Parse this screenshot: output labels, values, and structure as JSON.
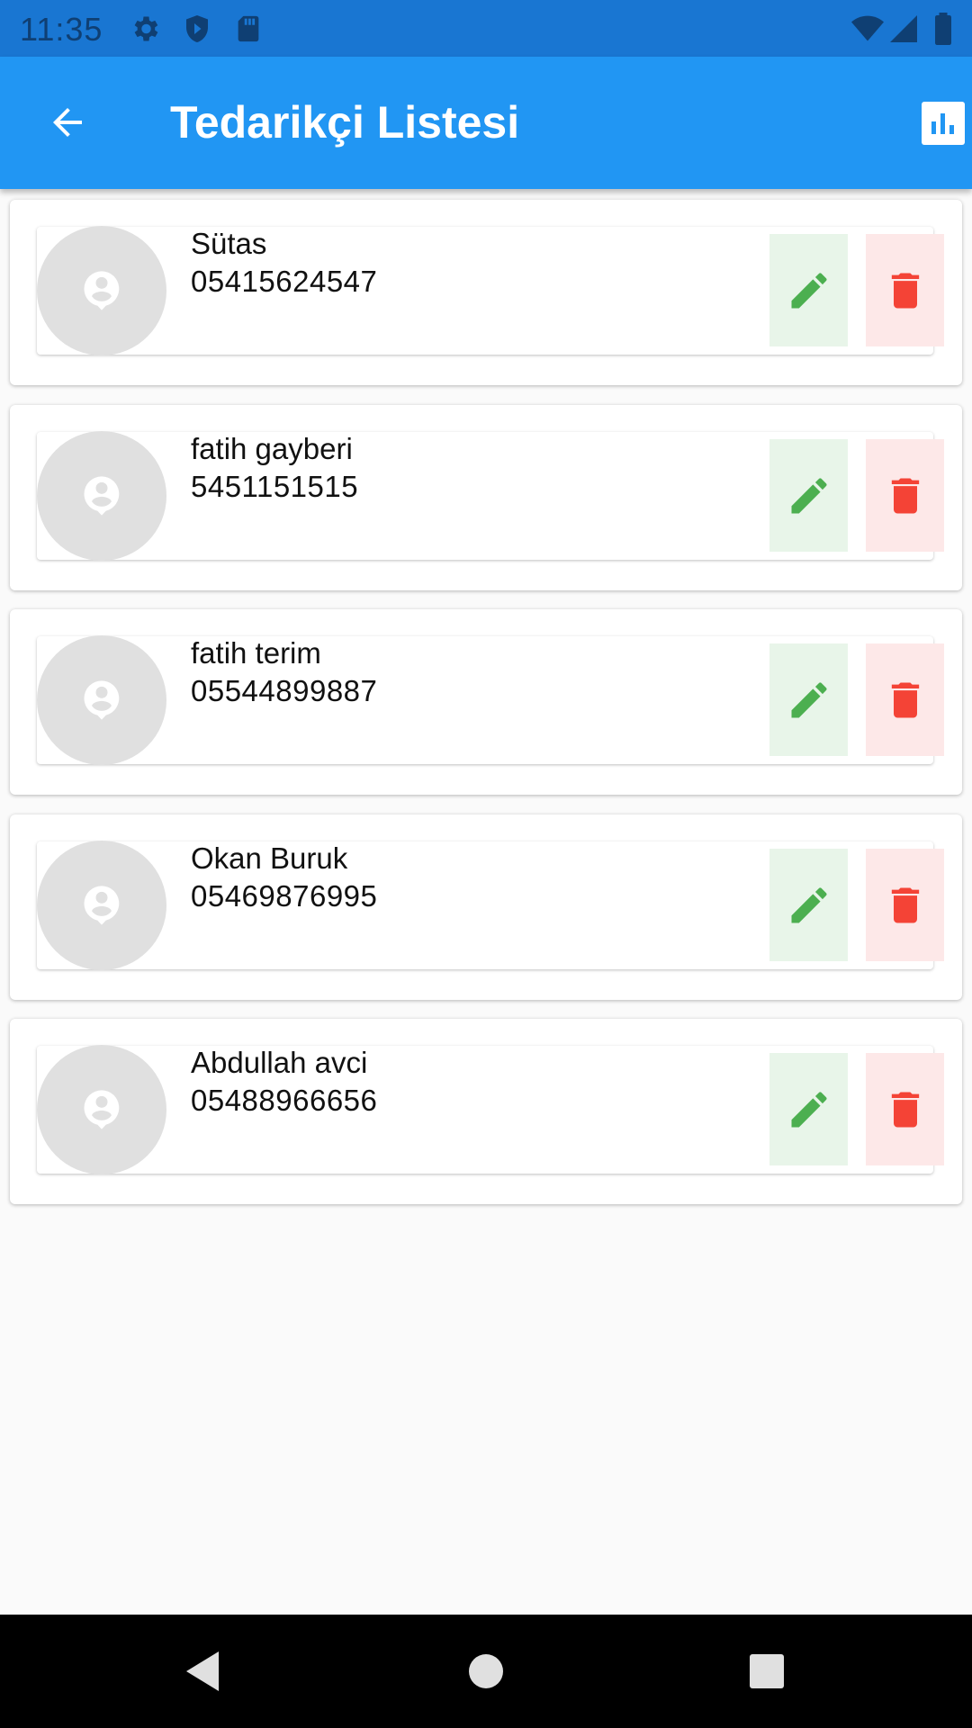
{
  "status_bar": {
    "time": "11:35",
    "icons": [
      "gear-icon",
      "shield-icon",
      "sd-card-icon"
    ],
    "right_icons": [
      "wifi-icon",
      "signal-icon",
      "battery-icon"
    ]
  },
  "app_bar": {
    "title": "Tedarikçi Listesi",
    "back_icon": "arrow-back-icon",
    "action_icon": "bar-chart-icon"
  },
  "colors": {
    "status_bar": "#1976d2",
    "app_bar": "#2196f3",
    "edit": "#4caf50",
    "edit_bg": "#e8f5e9",
    "delete": "#f44336",
    "delete_bg": "#fde8e8",
    "avatar": "#e0e0e0"
  },
  "suppliers": [
    {
      "name": "Sütas",
      "phone": "05415624547"
    },
    {
      "name": "fatih gayberi",
      "phone": "5451151515"
    },
    {
      "name": "fatih terim",
      "phone": "05544899887"
    },
    {
      "name": "Okan Buruk",
      "phone": "05469876995"
    },
    {
      "name": "Abdullah avci",
      "phone": "05488966656"
    }
  ],
  "nav_bar": {
    "icons": [
      "nav-back-icon",
      "nav-home-icon",
      "nav-recents-icon"
    ]
  }
}
